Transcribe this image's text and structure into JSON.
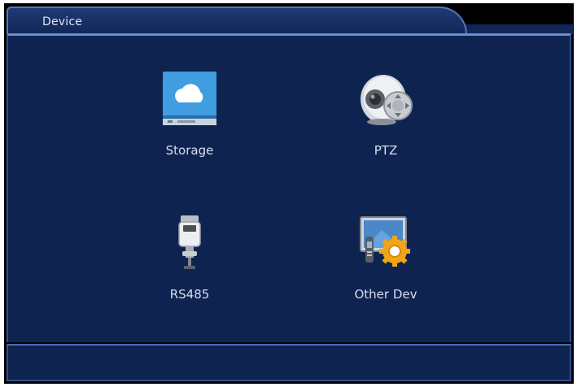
{
  "window": {
    "title": "Device"
  },
  "menu": {
    "items": [
      {
        "label": "Storage",
        "icon": "cloud-storage-icon"
      },
      {
        "label": "PTZ",
        "icon": "ptz-camera-icon"
      },
      {
        "label": "RS485",
        "icon": "surveillance-camera-icon"
      },
      {
        "label": "Other Dev",
        "icon": "monitor-gear-icon"
      }
    ]
  },
  "colors": {
    "panel": "#0f2350",
    "accent_border": "#6d8fd0",
    "storage_blue": "#3f9de0",
    "gear_orange": "#f2a516"
  }
}
